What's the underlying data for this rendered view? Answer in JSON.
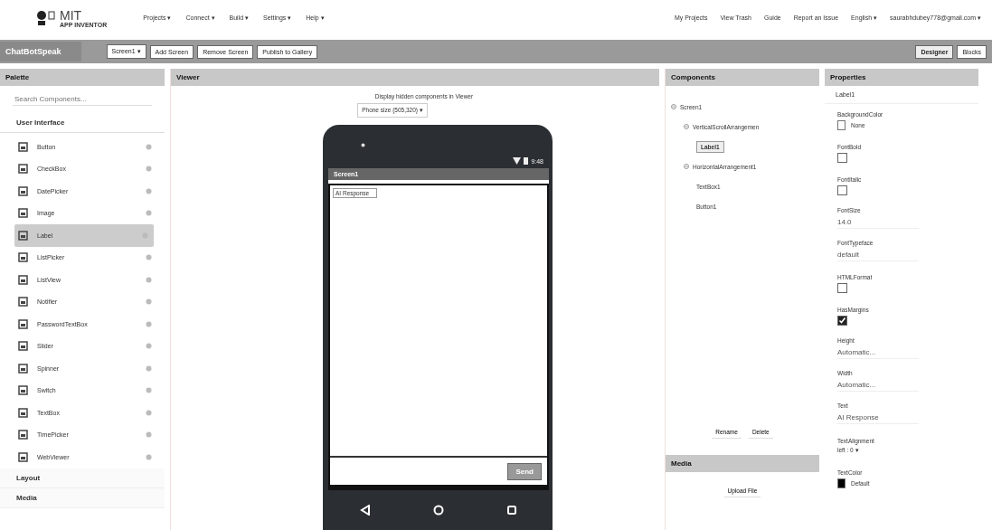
{
  "logo": {
    "title": "MIT",
    "subtitle": "APP INVENTOR"
  },
  "menus": [
    "Projects ▾",
    "Connect ▾",
    "Build ▾",
    "Settings ▾",
    "Help ▾"
  ],
  "top_links": [
    "My Projects",
    "View Trash",
    "Guide",
    "Report an Issue",
    "English ▾",
    "saurabhdubey778@gmail.com ▾"
  ],
  "project_name": "ChatBotSpeak",
  "toolbar_buttons": [
    "Screen1 ▾",
    "Add Screen",
    "Remove Screen",
    "Publish to Gallery"
  ],
  "view_buttons": [
    {
      "label": "Designer",
      "selected": true
    },
    {
      "label": "Blocks",
      "selected": false
    }
  ],
  "palette": {
    "title": "Palette",
    "search": {
      "placeholder": "Search Components..."
    },
    "section": "User Interface",
    "items": [
      {
        "label": "Button",
        "selected": false
      },
      {
        "label": "CheckBox",
        "selected": false
      },
      {
        "label": "DatePicker",
        "selected": false
      },
      {
        "label": "Image",
        "selected": false
      },
      {
        "label": "Label",
        "selected": true
      },
      {
        "label": "ListPicker",
        "selected": false
      },
      {
        "label": "ListView",
        "selected": false
      },
      {
        "label": "Notifier",
        "selected": false
      },
      {
        "label": "PasswordTextBox",
        "selected": false
      },
      {
        "label": "Slider",
        "selected": false
      },
      {
        "label": "Spinner",
        "selected": false
      },
      {
        "label": "Switch",
        "selected": false
      },
      {
        "label": "TextBox",
        "selected": false
      },
      {
        "label": "TimePicker",
        "selected": false
      },
      {
        "label": "WebViewer",
        "selected": false
      }
    ],
    "more_sections": [
      "Layout",
      "Media"
    ]
  },
  "viewer": {
    "title": "Viewer",
    "hidden_option": "Display hidden components in Viewer",
    "phone_size": "Phone size (505,320) ▾",
    "status_time": "9:48",
    "screen_title": "Screen1",
    "label_text": "AI Response",
    "button_text": "Send"
  },
  "components": {
    "title": "Components",
    "tree": [
      {
        "label": "Screen1",
        "selected": false,
        "children": [
          {
            "label": "VerticalScrollArrangemen",
            "selected": false,
            "children": [
              {
                "label": "Label1",
                "selected": true
              }
            ]
          },
          {
            "label": "HorizontalArrangement1",
            "selected": false,
            "children": [
              {
                "label": "TextBox1",
                "selected": false
              },
              {
                "label": "Button1",
                "selected": false
              }
            ]
          }
        ]
      }
    ],
    "buttons": [
      "Rename",
      "Delete"
    ]
  },
  "media": {
    "title": "Media",
    "button": "Upload File"
  },
  "properties": {
    "title": "Properties",
    "component": "Label1",
    "items": [
      {
        "kind": "color",
        "label": "BackgroundColor",
        "value": "None",
        "color": "#ffffff"
      },
      {
        "kind": "checkbox",
        "label": "FontBold",
        "checked": false
      },
      {
        "kind": "checkbox",
        "label": "FontItalic",
        "checked": false
      },
      {
        "kind": "text",
        "label": "FontSize",
        "value": "14.0"
      },
      {
        "kind": "text",
        "label": "FontTypeface",
        "value": "default"
      },
      {
        "kind": "checkbox",
        "label": "HTMLFormat",
        "checked": false
      },
      {
        "kind": "checkbox",
        "label": "HasMargins",
        "checked": true
      },
      {
        "kind": "text",
        "label": "Height",
        "value": "Automatic..."
      },
      {
        "kind": "text",
        "label": "Width",
        "value": "Automatic..."
      },
      {
        "kind": "text",
        "label": "Text",
        "value": "AI Response"
      },
      {
        "kind": "dropdown",
        "label": "TextAlignment",
        "value": "left : 0 ▾"
      },
      {
        "kind": "color",
        "label": "TextColor",
        "value": "Default",
        "color": "#000000"
      }
    ]
  }
}
